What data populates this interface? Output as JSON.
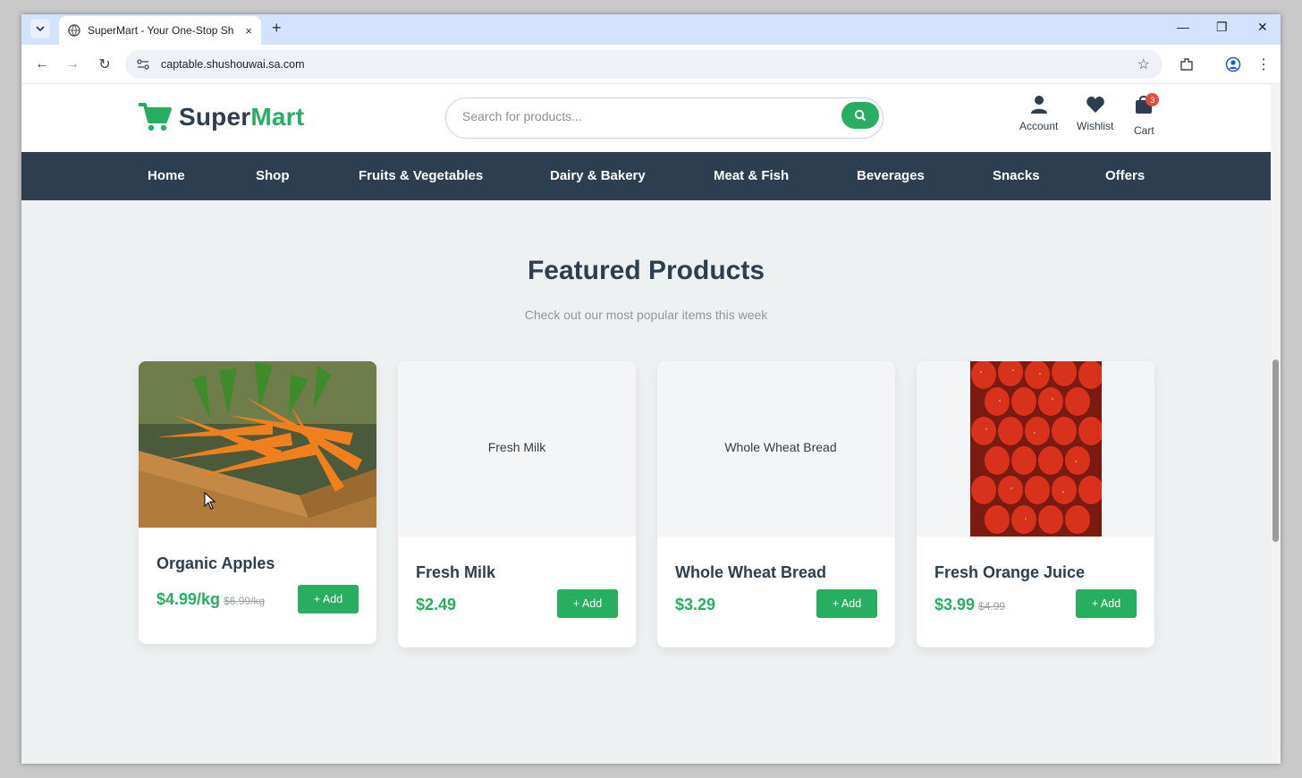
{
  "browser": {
    "tab_title": "SuperMart - Your One-Stop Sho",
    "tab_close": "×",
    "new_tab": "+",
    "url": "captable.shushouwai.sa.com",
    "win_minimize": "—",
    "win_restore": "❐",
    "win_close": "✕"
  },
  "site": {
    "logo_part1": "Super",
    "logo_part2": "Mart",
    "search_placeholder": "Search for products...",
    "actions": [
      {
        "label": "Account",
        "icon": "user-icon"
      },
      {
        "label": "Wishlist",
        "icon": "heart-icon"
      },
      {
        "label": "Cart",
        "icon": "bag-icon",
        "badge": "3"
      }
    ],
    "accent_color": "#27ae60",
    "nav_color": "#2c3e50"
  },
  "nav": [
    "Home",
    "Shop",
    "Fruits & Vegetables",
    "Dairy & Bakery",
    "Meat & Fish",
    "Beverages",
    "Snacks",
    "Offers"
  ],
  "featured": {
    "title": "Featured Products",
    "subtitle": "Check out our most popular items this week",
    "add_label": "+ Add",
    "products": [
      {
        "name": "Organic Apples",
        "price": "$4.99/kg",
        "old_price": "$6.99/kg",
        "image": "carrots-photo"
      },
      {
        "name": "Fresh Milk",
        "price": "$2.49",
        "old_price": "",
        "image_alt": "Fresh Milk"
      },
      {
        "name": "Whole Wheat Bread",
        "price": "$3.29",
        "old_price": "",
        "image_alt": "Whole Wheat Bread"
      },
      {
        "name": "Fresh Orange Juice",
        "price": "$3.99",
        "old_price": "$4.99",
        "image": "strawberries-photo"
      }
    ]
  }
}
